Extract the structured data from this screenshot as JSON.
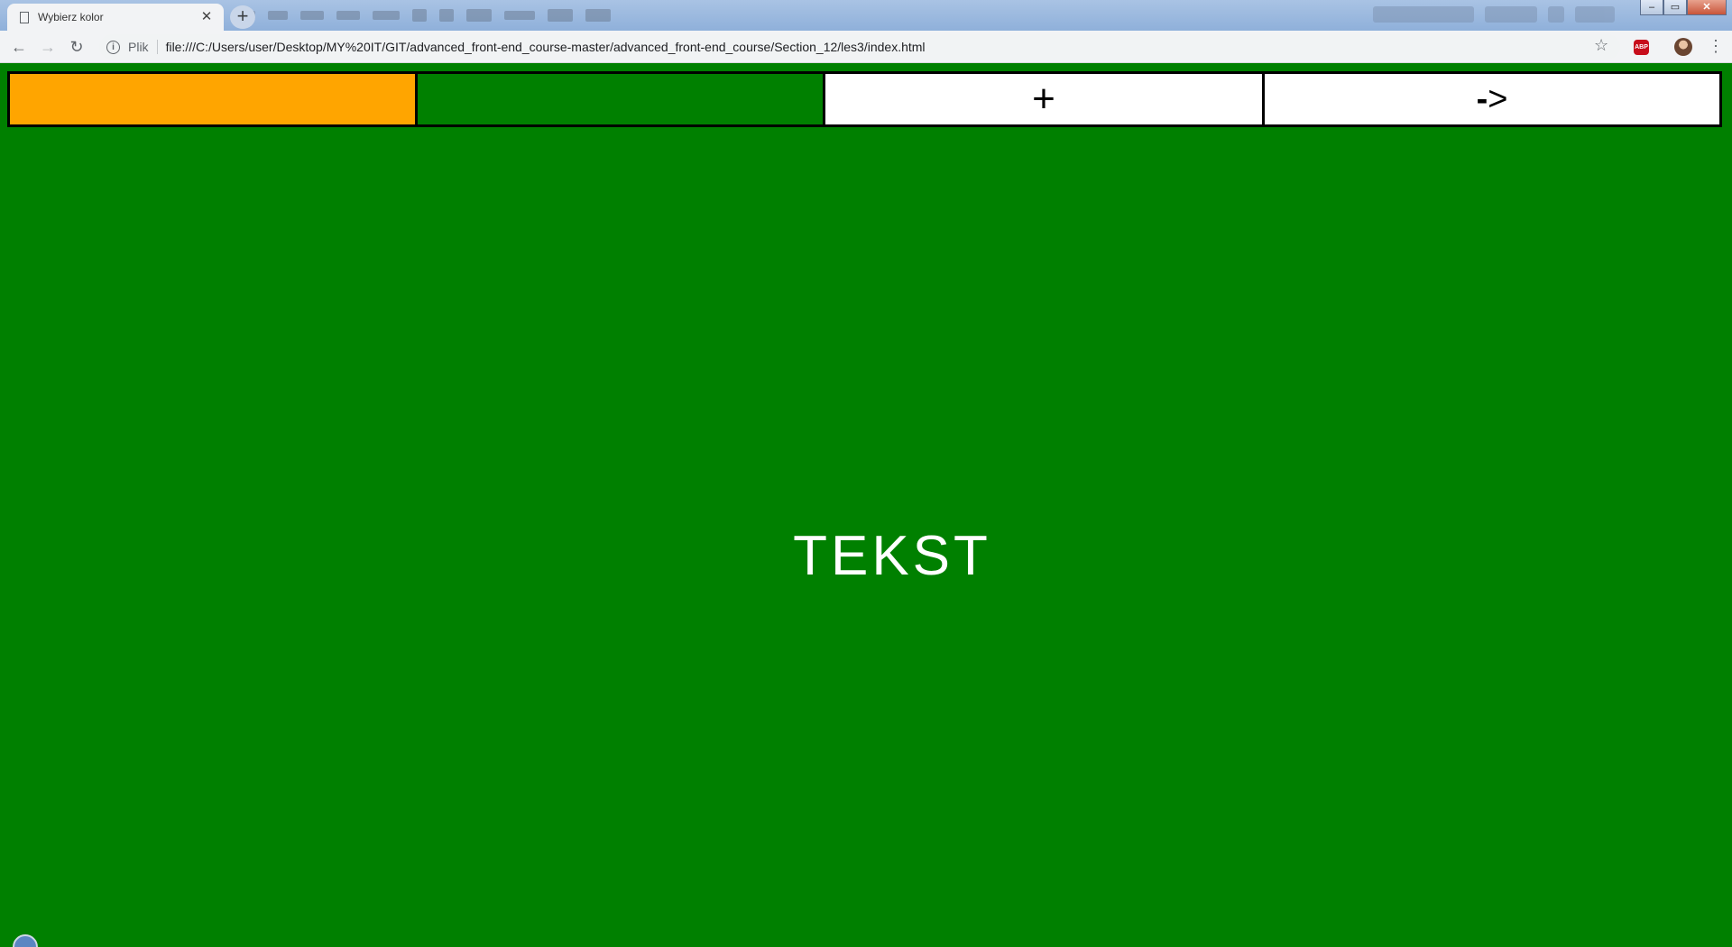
{
  "browser": {
    "tab_title": "Wybierz kolor",
    "tab_close_glyph": "✕",
    "new_tab_glyph": "+",
    "window_controls": {
      "minimize_glyph": "–",
      "maximize_glyph": "▭",
      "close_glyph": "✕"
    },
    "nav": {
      "back_glyph": "←",
      "forward_glyph": "→",
      "reload_glyph": "↻"
    },
    "address_bar": {
      "info_glyph": "i",
      "scheme_label": "Plik",
      "url": "file:///C:/Users/user/Desktop/MY%20IT/GIT/advanced_front-end_course-master/advanced_front-end_course/Section_12/les3/index.html"
    },
    "bookmark_glyph": "☆",
    "extension_abp_label": "ABP",
    "menu_glyph": "⋮"
  },
  "page": {
    "background_color": "#008000",
    "buttons": [
      {
        "label": "",
        "color": "#ffa500"
      },
      {
        "label": "",
        "color": "#008000"
      },
      {
        "label": "+",
        "color": "#ffffff"
      },
      {
        "label_dash": "-",
        "label_arrow": ">",
        "color": "#ffffff"
      }
    ],
    "text": "TEKST",
    "text_color": "#ffffff"
  }
}
